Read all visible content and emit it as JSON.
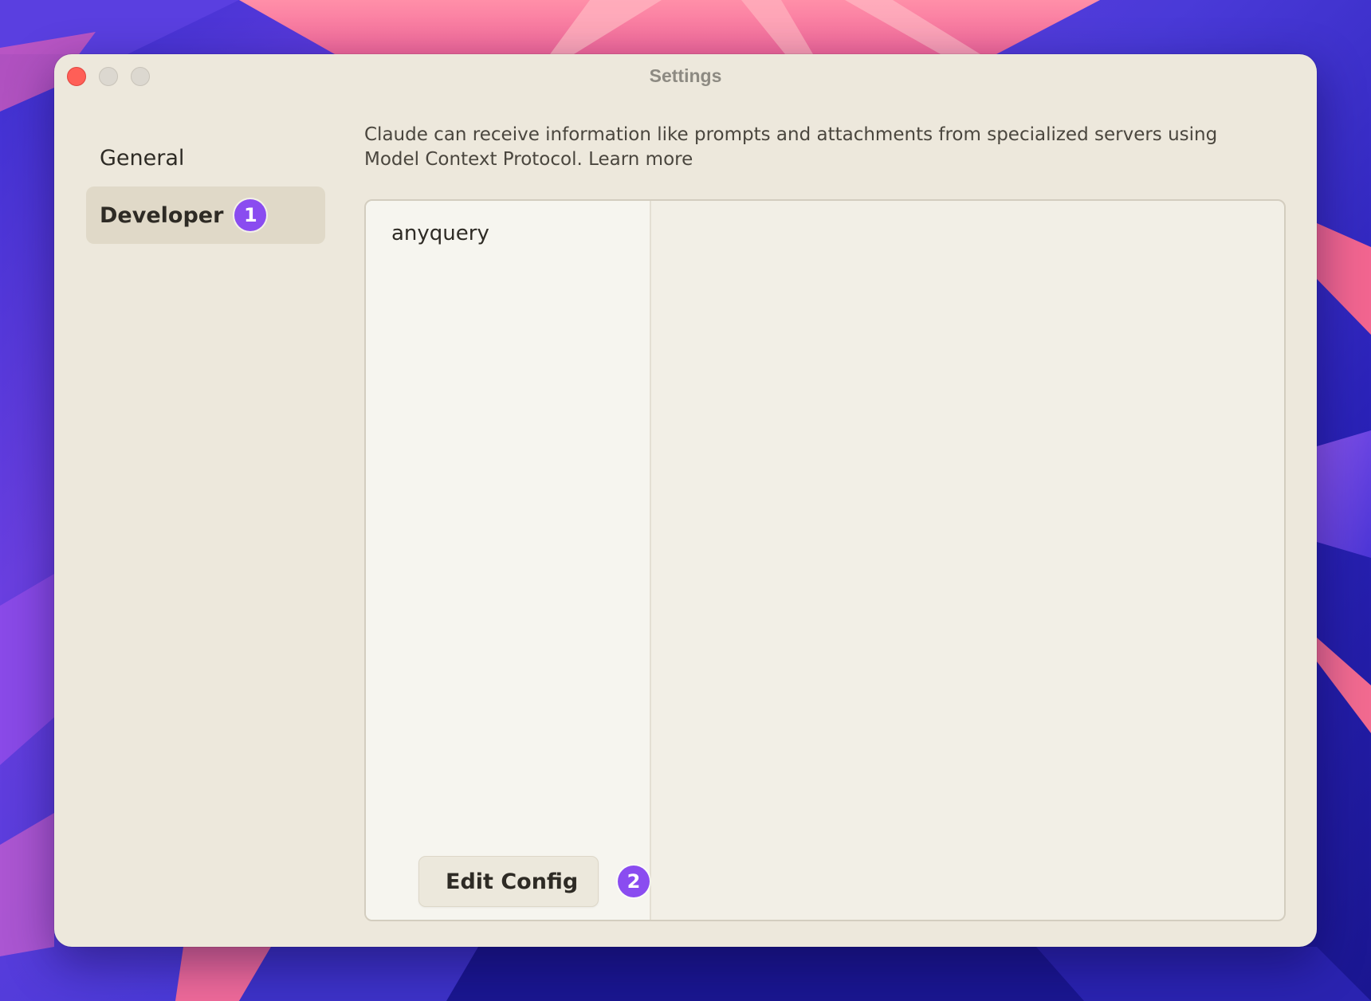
{
  "window": {
    "title": "Settings"
  },
  "sidebar": {
    "items": [
      {
        "label": "General",
        "active": false
      },
      {
        "label": "Developer",
        "active": true,
        "badge": "1"
      }
    ]
  },
  "main": {
    "description": "Claude can receive information like prompts and attachments from specialized servers using Model Context Protocol. Learn more",
    "servers": [
      "anyquery"
    ],
    "edit_config_label": "Edit Config",
    "edit_config_badge": "2"
  },
  "colors": {
    "accent_badge": "#8a4cf0",
    "window_bg": "#ede8dc",
    "close_button": "#ff5f57"
  }
}
